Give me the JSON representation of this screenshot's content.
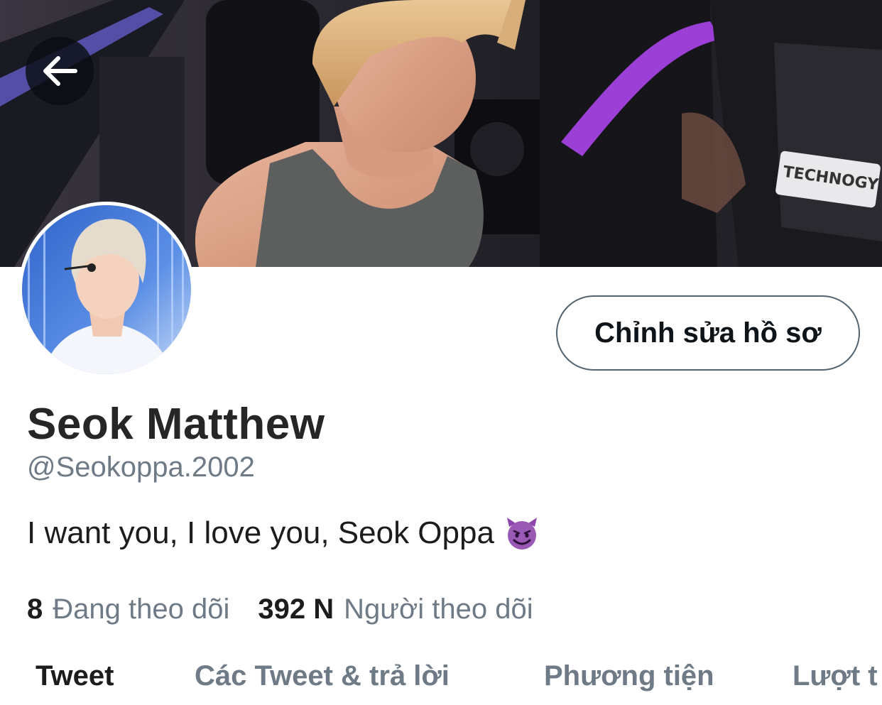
{
  "header": {
    "back_icon": "arrow-left-icon",
    "banner_text": "TECHNOGY"
  },
  "profile": {
    "edit_button_label": "Chỉnh sửa hồ sơ",
    "name": "Seok Matthew",
    "handle": "@Seokoppa.2002",
    "bio": "I want you, I love you, Seok Oppa",
    "bio_emoji_icon": "smiling-devil-emoji-icon"
  },
  "stats": {
    "following": {
      "count": "8",
      "label": "Đang theo dõi"
    },
    "followers": {
      "count": "392 N",
      "label": "Người theo dõi"
    }
  },
  "tabs": [
    {
      "label": "Tweet",
      "active": true
    },
    {
      "label": "Các Tweet & trả lời",
      "active": false
    },
    {
      "label": "Phương tiện",
      "active": false
    },
    {
      "label": "Lượt t",
      "active": false
    }
  ],
  "colors": {
    "primary_text": "#0f1419",
    "secondary_text": "#6e7a86",
    "button_border": "#536471",
    "emoji_purple": "#8e44ad"
  }
}
